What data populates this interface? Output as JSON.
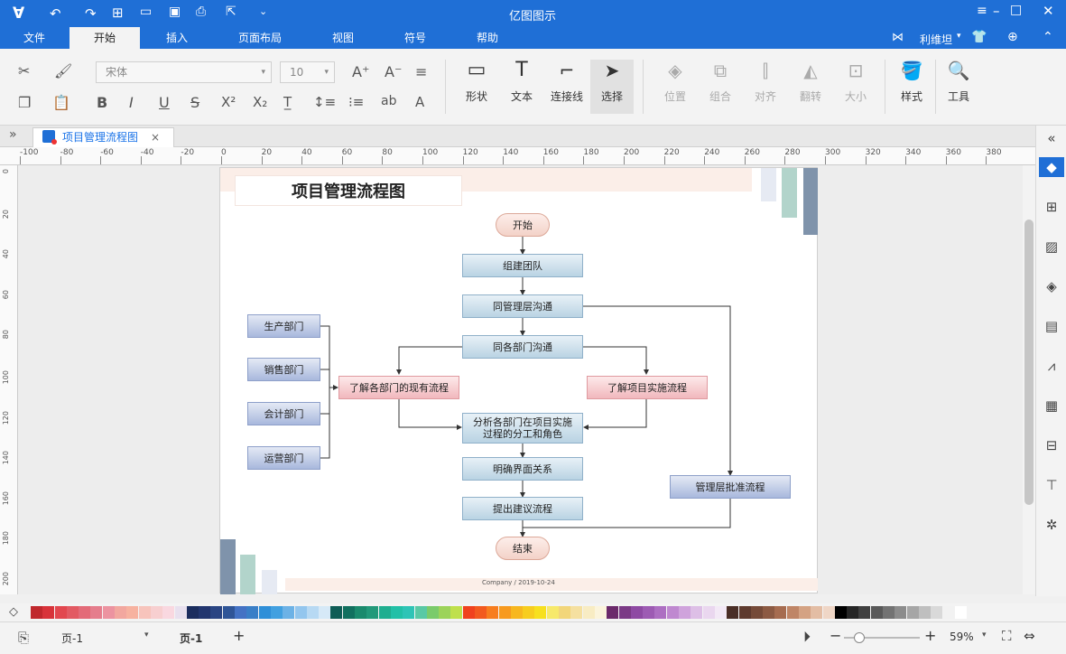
{
  "app": {
    "title": "亿图图示",
    "user": "利维坦"
  },
  "menu": {
    "tabs": [
      "文件",
      "开始",
      "插入",
      "页面布局",
      "视图",
      "符号",
      "帮助"
    ],
    "active": "开始"
  },
  "ribbon": {
    "font_family": "宋体",
    "font_size": "10",
    "buttons": {
      "shape": "形状",
      "text": "文本",
      "connector": "连接线",
      "select": "选择",
      "position": "位置",
      "group": "组合",
      "align": "对齐",
      "flip": "翻转",
      "size": "大小",
      "style": "样式",
      "tools": "工具"
    }
  },
  "document_tab": {
    "title": "项目管理流程图",
    "close": "×"
  },
  "ruler": {
    "top_ticks": [
      "-100",
      "-80",
      "-60",
      "-40",
      "-20",
      "0",
      "20",
      "40",
      "60",
      "80",
      "100",
      "120",
      "140",
      "160",
      "180",
      "200",
      "220",
      "240",
      "260",
      "280",
      "300",
      "320",
      "340",
      "360",
      "380"
    ],
    "left_ticks": [
      "0",
      "20",
      "40",
      "60",
      "80",
      "100",
      "120",
      "140",
      "160",
      "180",
      "200"
    ]
  },
  "diagram": {
    "title": "项目管理流程图",
    "start": "开始",
    "team": "组建团队",
    "mgmt_comm": "同管理层沟通",
    "dept_comm": "同各部门沟通",
    "dept_production": "生产部门",
    "dept_sales": "销售部门",
    "dept_accounting": "会计部门",
    "dept_operations": "运营部门",
    "understand_current": "了解各部门的现有流程",
    "understand_project": "了解项目实施流程",
    "analyze_line1": "分析各部门在项目实施",
    "analyze_line2": "过程的分工和角色",
    "interface": "明确界面关系",
    "proposal": "提出建议流程",
    "approval": "管理层批准流程",
    "end": "结束",
    "footer": "Company  /  2019-10-24"
  },
  "status": {
    "page_selector": "页-1",
    "page_tab": "页-1",
    "add_page": "+",
    "zoom": "59%"
  },
  "colors": {
    "accent": "#1f6fd6"
  },
  "palette": [
    "#c0282d",
    "#d8333a",
    "#e2474f",
    "#e25a63",
    "#e36b78",
    "#e57d8c",
    "#ec93a0",
    "#f2a79f",
    "#f7b2a0",
    "#f7c4bc",
    "#f7cfd0",
    "#f9d8e0",
    "#e8e0ee",
    "#1b2d5e",
    "#22366f",
    "#2a4583",
    "#2f5597",
    "#4472c4",
    "#3a7fc7",
    "#2f8fd8",
    "#41a0e0",
    "#6cb2e6",
    "#93c6ee",
    "#b7d9f3",
    "#d6e9f7",
    "#0f5d56",
    "#11705f",
    "#1a8a6d",
    "#22997a",
    "#1fae90",
    "#22c0a7",
    "#2ec4b6",
    "#59c9a5",
    "#7acb6b",
    "#9cd35a",
    "#bfe04c",
    "#f0421e",
    "#f25a1f",
    "#f77d1f",
    "#f79a1f",
    "#f7b71f",
    "#f7cd1f",
    "#f7e01f",
    "#f7e96b",
    "#f2d67a",
    "#f5e0a0",
    "#f8ecc3",
    "#fbf4dc",
    "#6b2a6b",
    "#7b3a86",
    "#8e4aa3",
    "#9d5bb3",
    "#ad6fc2",
    "#bf88d0",
    "#cfa3dc",
    "#ddbfe6",
    "#ead7ef",
    "#f3e9f6",
    "#4a2e26",
    "#5e3a2e",
    "#754a38",
    "#8c5a43",
    "#a66c50",
    "#bf8566",
    "#d4a283",
    "#e3bda4",
    "#efd6c6",
    "#000000",
    "#262626",
    "#404040",
    "#595959",
    "#737373",
    "#8c8c8c",
    "#a6a6a6",
    "#bfbfbf",
    "#d9d9d9",
    "#f2f2f2",
    "#ffffff"
  ]
}
